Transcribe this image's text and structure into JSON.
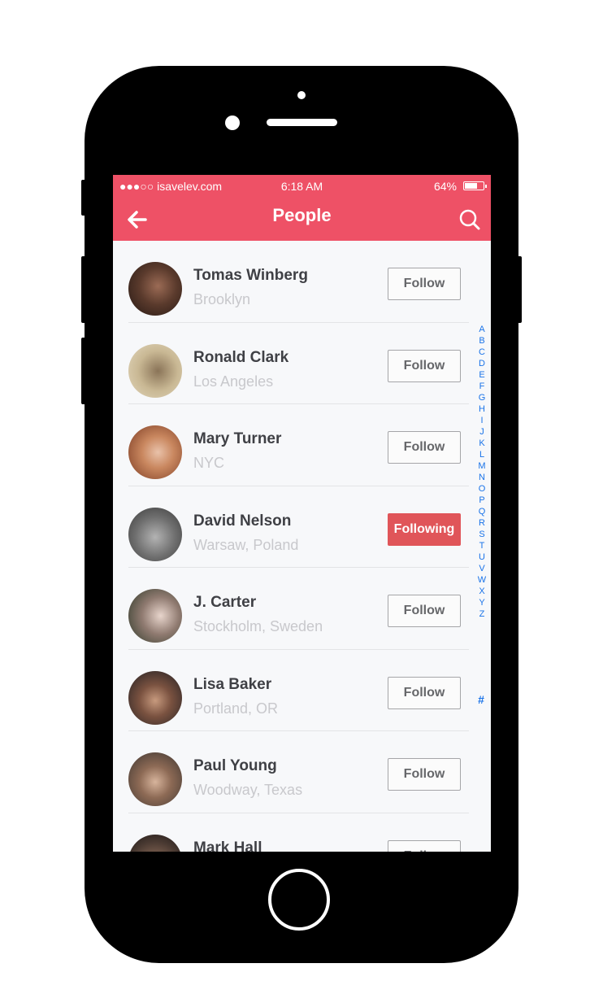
{
  "status_bar": {
    "carrier": "●●●○○ isavelev.com",
    "time": "6:18 AM",
    "battery": "64%"
  },
  "header": {
    "title": "People",
    "back_icon": "arrow-left-icon",
    "search_icon": "search-icon"
  },
  "colors": {
    "accent": "#ee5166",
    "following_bg": "#e05559",
    "index": "#1a73e8"
  },
  "people": [
    {
      "name": "Tomas Winberg",
      "location": "Brooklyn",
      "button": "Follow",
      "following": false
    },
    {
      "name": "Ronald Clark",
      "location": "Los Angeles",
      "button": "Follow",
      "following": false
    },
    {
      "name": "Mary Turner",
      "location": "NYC",
      "button": "Follow",
      "following": false
    },
    {
      "name": "David Nelson",
      "location": "Warsaw, Poland",
      "button": "Following",
      "following": true
    },
    {
      "name": "J. Carter",
      "location": "Stockholm, Sweden",
      "button": "Follow",
      "following": false
    },
    {
      "name": "Lisa Baker",
      "location": "Portland, OR",
      "button": "Follow",
      "following": false
    },
    {
      "name": "Paul Young",
      "location": "Woodway, Texas",
      "button": "Follow",
      "following": false
    },
    {
      "name": "Mark Hall",
      "location": "",
      "button": "Follow",
      "following": false
    }
  ],
  "index_letters": [
    "A",
    "B",
    "C",
    "D",
    "E",
    "F",
    "G",
    "H",
    "I",
    "J",
    "K",
    "L",
    "M",
    "N",
    "O",
    "P",
    "Q",
    "R",
    "S",
    "T",
    "U",
    "V",
    "W",
    "X",
    "Y",
    "Z"
  ],
  "index_hash": "#"
}
